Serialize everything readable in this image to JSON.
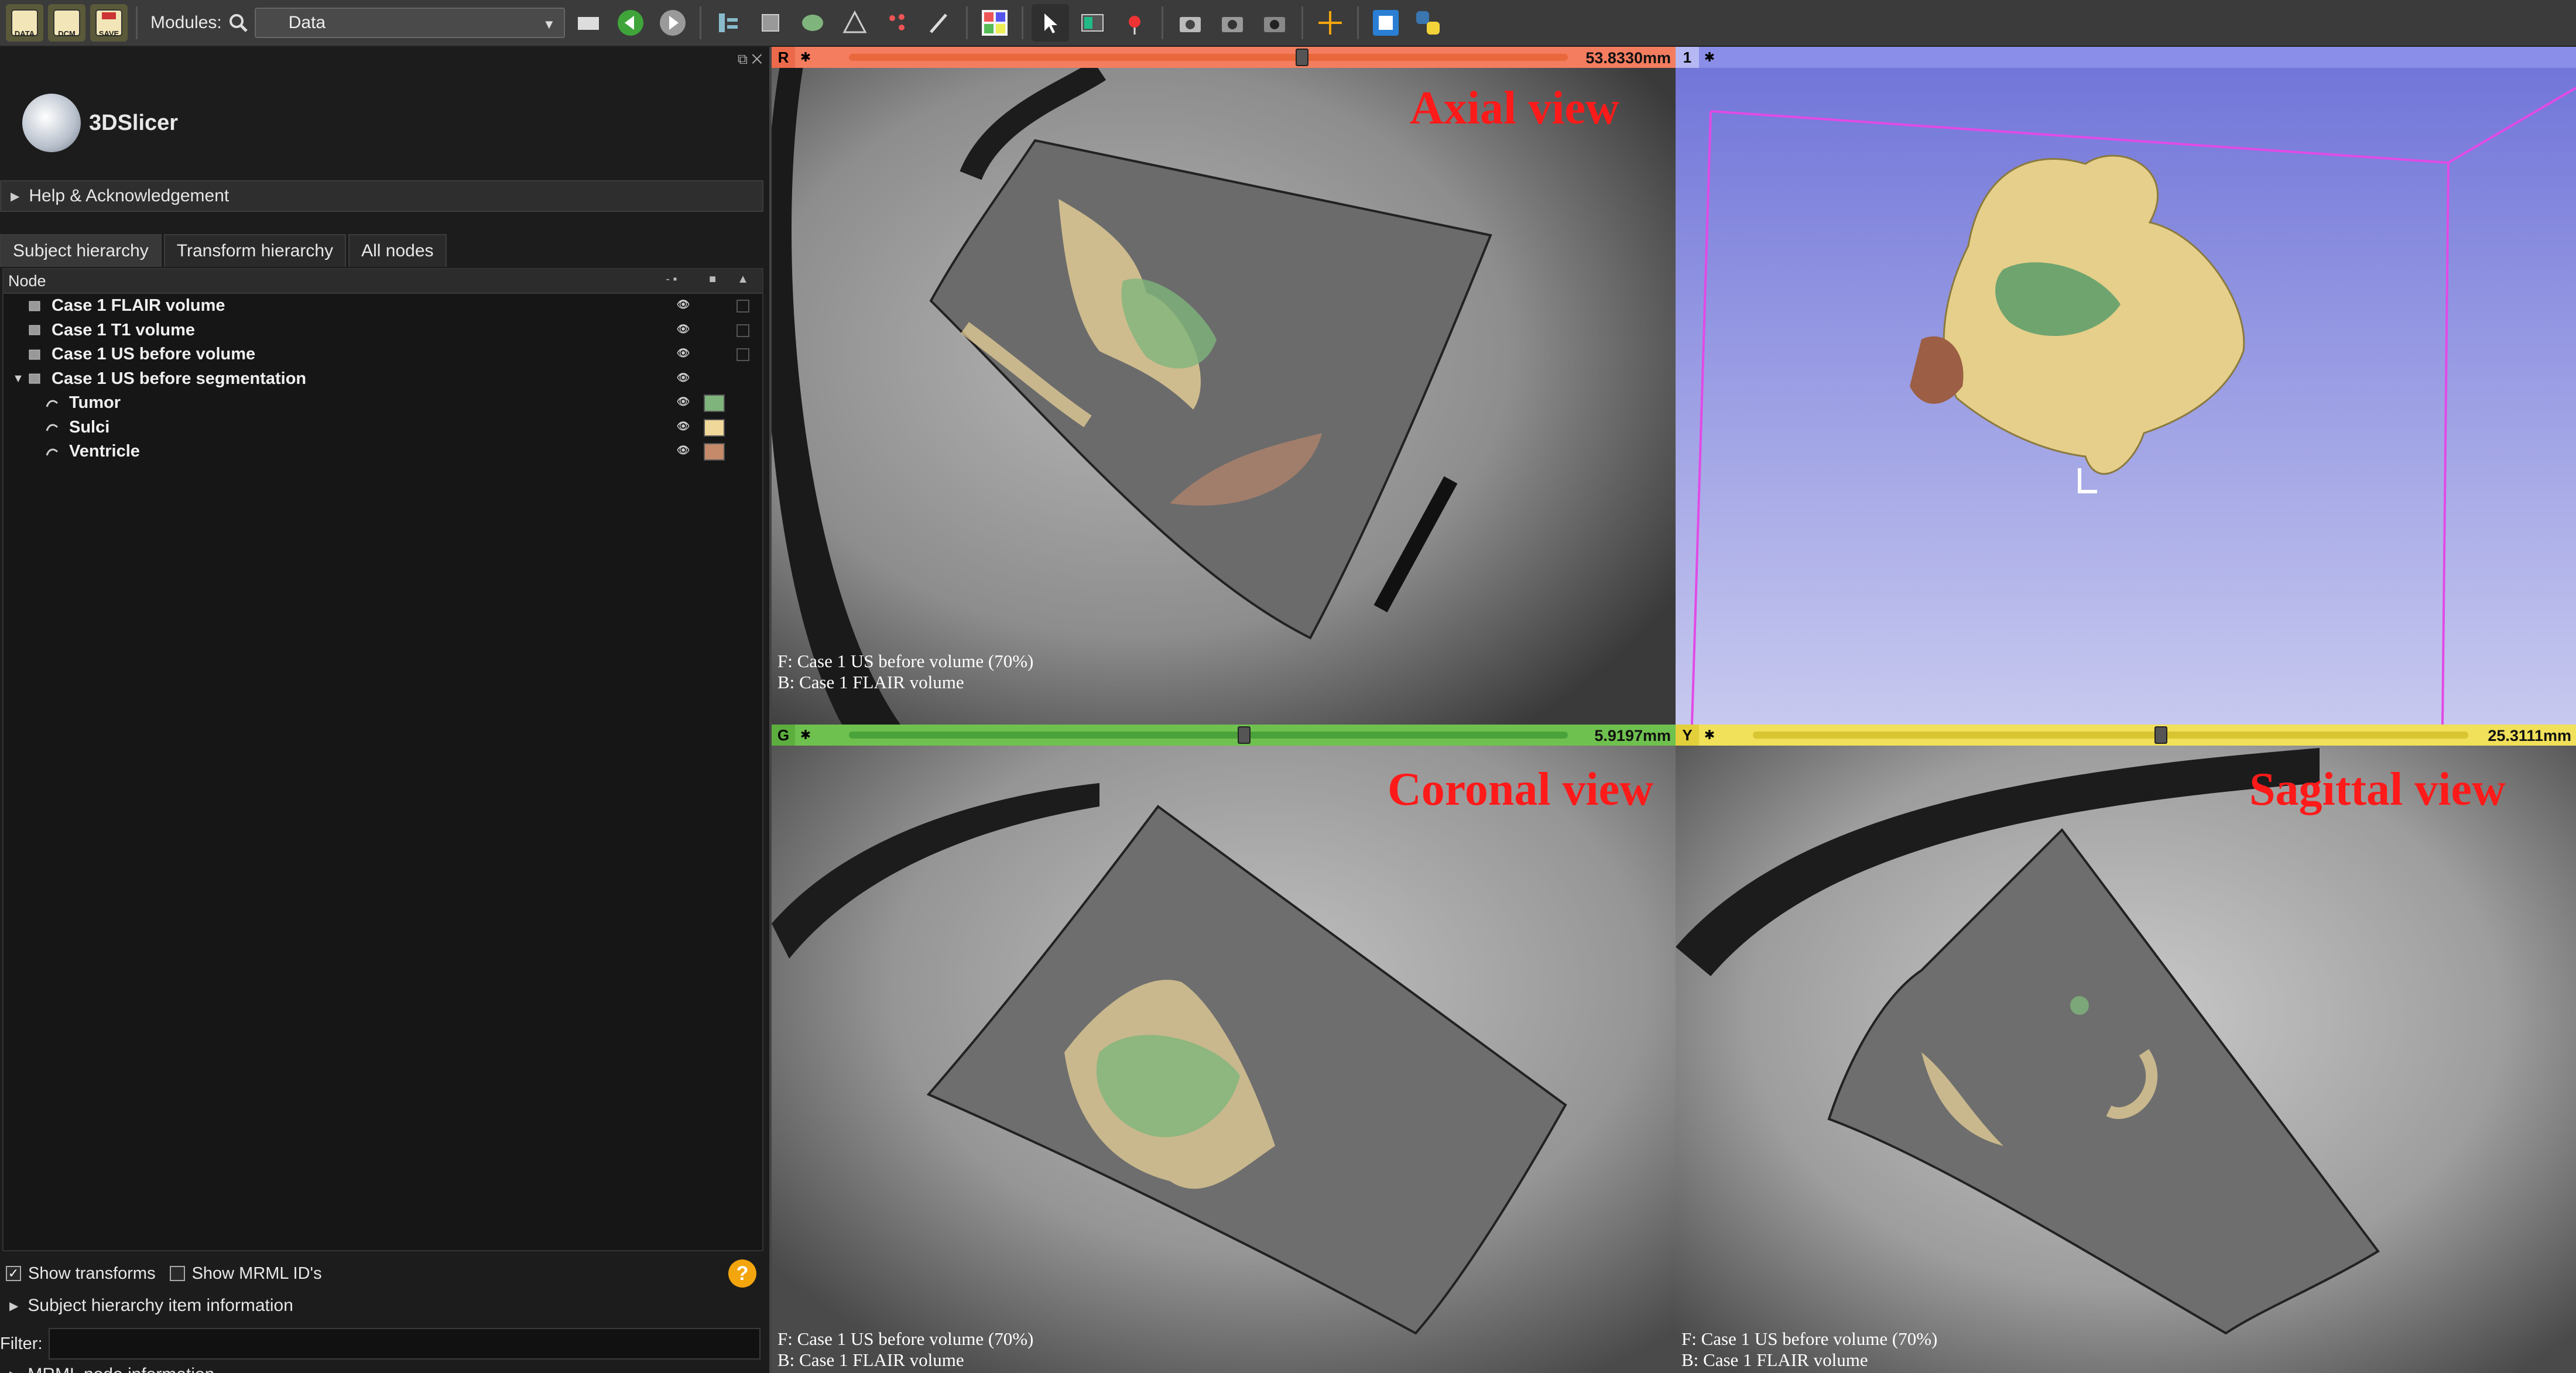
{
  "toolbar": {
    "buttons": [
      {
        "icon": "load-data-icon",
        "label": "DATA"
      },
      {
        "icon": "load-dicom-icon",
        "label": "DCM"
      },
      {
        "icon": "save-icon",
        "label": "SAVE"
      }
    ],
    "modules_label": "Modules:",
    "module_select_value": "Data"
  },
  "app": {
    "name": "3DSlicer"
  },
  "panel": {
    "help_section": "Help & Acknowledgement",
    "tabs": [
      "Subject hierarchy",
      "Transform hierarchy",
      "All nodes"
    ],
    "tree_header": "Node",
    "tree_items": [
      {
        "label": "Case 1 FLAIR volume",
        "depth": 0,
        "expandable": false,
        "swatch": null
      },
      {
        "label": "Case 1 T1 volume",
        "depth": 0,
        "expandable": false,
        "swatch": null
      },
      {
        "label": "Case 1 US before volume",
        "depth": 0,
        "expandable": false,
        "swatch": null
      },
      {
        "label": "Case 1 US before segmentation",
        "depth": 0,
        "expandable": true,
        "swatch": null
      },
      {
        "label": "Tumor",
        "depth": 1,
        "expandable": false,
        "swatch": "#7fb57c"
      },
      {
        "label": "Sulci",
        "depth": 1,
        "expandable": false,
        "swatch": "#f0d79a"
      },
      {
        "label": "Ventricle",
        "depth": 1,
        "expandable": false,
        "swatch": "#c48a6a"
      }
    ],
    "show_transforms": {
      "label": "Show transforms",
      "checked": true
    },
    "show_mrml_ids": {
      "label": "Show MRML ID's",
      "checked": false
    },
    "subject_item_info": "Subject hierarchy item information",
    "filter_label": "Filter:",
    "filter_value": "",
    "mrml_node_info": "MRML node information"
  },
  "views": {
    "axial": {
      "tag": "R",
      "offset": "53.8330mm",
      "slider_fraction": 0.63,
      "title": "Axial view",
      "fg_text": "F: Case 1 US before volume (70%)",
      "bg_text": "B: Case 1 FLAIR volume",
      "bar_color": "#f47d5f",
      "track_color": "#e8683c"
    },
    "threed": {
      "tag": "1",
      "bar_color": "#8a8ee8",
      "bg_top": "#6f73d8",
      "bg_bottom": "#c7c9ef"
    },
    "coronal": {
      "tag": "G",
      "offset": "5.9197mm",
      "slider_fraction": 0.55,
      "title": "Coronal view",
      "fg_text": "F: Case 1 US before volume (70%)",
      "bg_text": "B: Case 1 FLAIR volume",
      "bar_color": "#6fc14f",
      "track_color": "#4aa23a"
    },
    "sagittal": {
      "tag": "Y",
      "offset": "25.3111mm",
      "slider_fraction": 0.57,
      "title": "Sagittal view",
      "fg_text": "F: Case 1 US before volume (70%)",
      "bg_text": "B: Case 1 FLAIR volume",
      "bar_color": "#f1e05a",
      "track_color": "#d9c531"
    }
  },
  "segment_colors": {
    "tumor": "#7fb57c",
    "sulci": "#f0d79a",
    "ventricle": "#c48a6a"
  }
}
